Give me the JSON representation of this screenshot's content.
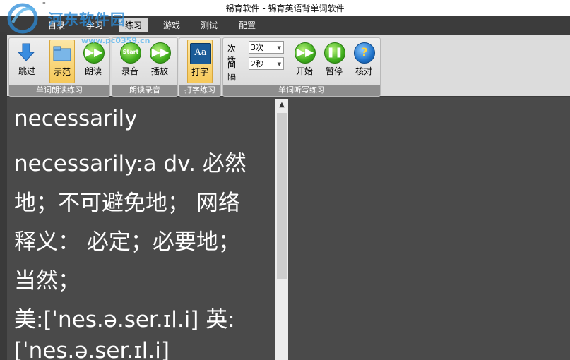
{
  "window": {
    "title": "锡育软件 - 锡育英语背单词软件",
    "quick_access": "⁼"
  },
  "watermark": {
    "text": "河东软件园",
    "url": "www.pc0359.cn"
  },
  "tabs": [
    {
      "label": "目录"
    },
    {
      "label": "学习"
    },
    {
      "label": "练习",
      "active": true
    },
    {
      "label": "游戏"
    },
    {
      "label": "测试"
    },
    {
      "label": "配置"
    }
  ],
  "ribbon": {
    "groups": [
      {
        "label": "单词朗读练习",
        "buttons": [
          {
            "label": "跳过",
            "icon": "download-arrow-icon"
          },
          {
            "label": "示范",
            "icon": "folder-icon",
            "selected": true
          },
          {
            "label": "朗读",
            "icon": "play-icon"
          }
        ]
      },
      {
        "label": "朗读录音",
        "buttons": [
          {
            "label": "录音",
            "icon": "start-icon"
          },
          {
            "label": "播放",
            "icon": "play-icon"
          }
        ]
      },
      {
        "label": "打字练习",
        "buttons": [
          {
            "label": "打字",
            "icon": "typing-icon",
            "selected": true
          }
        ]
      },
      {
        "label": "单词听写练习",
        "buttons": [
          {
            "label": "开始",
            "icon": "play-icon"
          },
          {
            "label": "暂停",
            "icon": "pause-icon"
          },
          {
            "label": "核对",
            "icon": "help-icon"
          }
        ]
      }
    ],
    "dictation": {
      "count_label": "次数",
      "count_value": "3次",
      "interval_label": "间隔",
      "interval_value": "2秒"
    },
    "icon_glyphs": {
      "typing": "Aa",
      "start": "Start",
      "help": "?"
    }
  },
  "content": {
    "lines": [
      "necessarily",
      "necessarily:a    dv. 必然",
      "地；不可避免地；  网络",
      "释义：  必定；必要地；",
      "当然；",
      "美:[ˈnes.ə.ser.ɪl.i]     英:",
      "[ˈnes.ə.ser.ɪl.i]"
    ]
  },
  "colors": {
    "ribbon_bg": "#dcdcdc",
    "group_label_bg": "#8e8e8e",
    "content_bg": "#4a4a4a",
    "selected_button": "#f6c95a",
    "play_green": "#3fae1c"
  }
}
